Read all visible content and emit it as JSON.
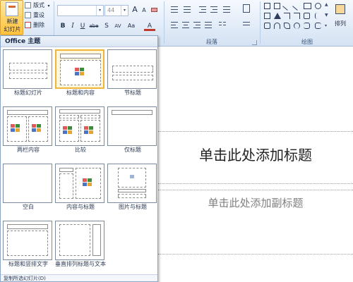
{
  "ribbon": {
    "slides_group": {
      "new_slide_line1": "新建",
      "new_slide_line2": "幻灯片",
      "layout_label": "版式",
      "reset_label": "重设",
      "delete_label": "删除"
    },
    "font_group": {
      "font_size": "44",
      "bold": "B",
      "italic": "I",
      "underline": "U",
      "strikethrough": "abe",
      "shadow": "S",
      "spacing": "AV",
      "case": "Aa",
      "grow": "A",
      "shrink": "A",
      "color": "A"
    },
    "paragraph_group": {
      "label": "段落"
    },
    "drawing_group": {
      "arrange_label": "排列",
      "label": "绘图"
    }
  },
  "gallery": {
    "header": "Office 主题",
    "layouts": [
      {
        "label": "标题幻灯片"
      },
      {
        "label": "标题和内容"
      },
      {
        "label": "节标题"
      },
      {
        "label": "两栏内容"
      },
      {
        "label": "比较"
      },
      {
        "label": "仅标题"
      },
      {
        "label": "空白"
      },
      {
        "label": "内容与标题"
      },
      {
        "label": "图片与标题"
      },
      {
        "label": "标题和竖排文字"
      },
      {
        "label": "垂直排列标题与文本"
      }
    ],
    "footer": "复制所选幻灯片(D)"
  },
  "slide": {
    "title_placeholder": "单击此处添加标题",
    "subtitle_placeholder": "单击此处添加副标题"
  },
  "colors": {
    "ribbon_bg": "#dbe6f4",
    "selected_highlight": "#f0b438",
    "new_slide_button": "#ffd46a"
  }
}
